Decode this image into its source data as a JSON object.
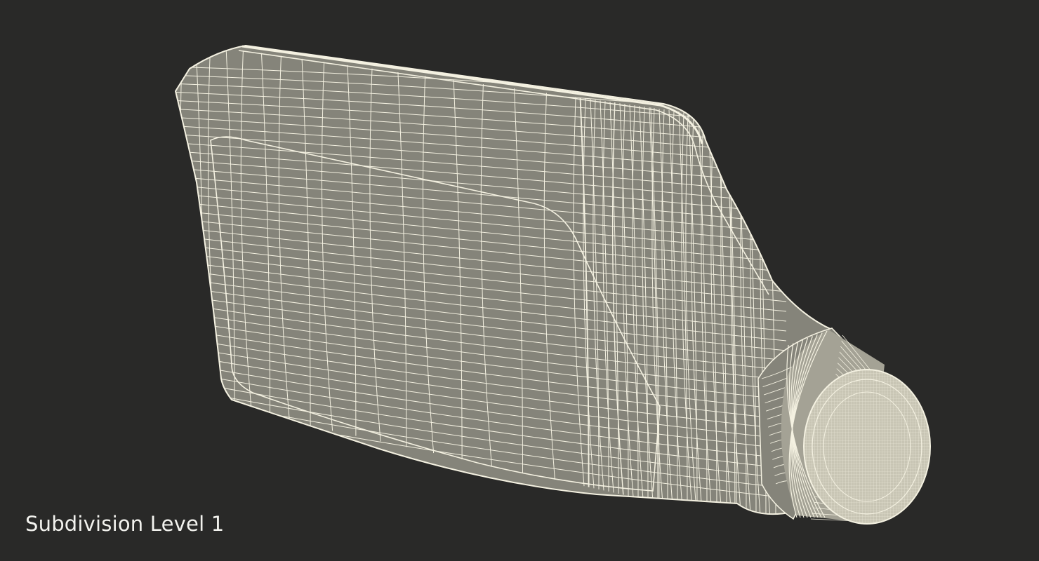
{
  "viewport": {
    "caption": "Subdivision Level 1",
    "colors": {
      "background": "#292928",
      "surface": "#85847a",
      "wire": "#f4f1e1",
      "caption_text": "#f2f2ee"
    }
  },
  "model": {
    "icon": "wireframe-bottle-mesh"
  }
}
